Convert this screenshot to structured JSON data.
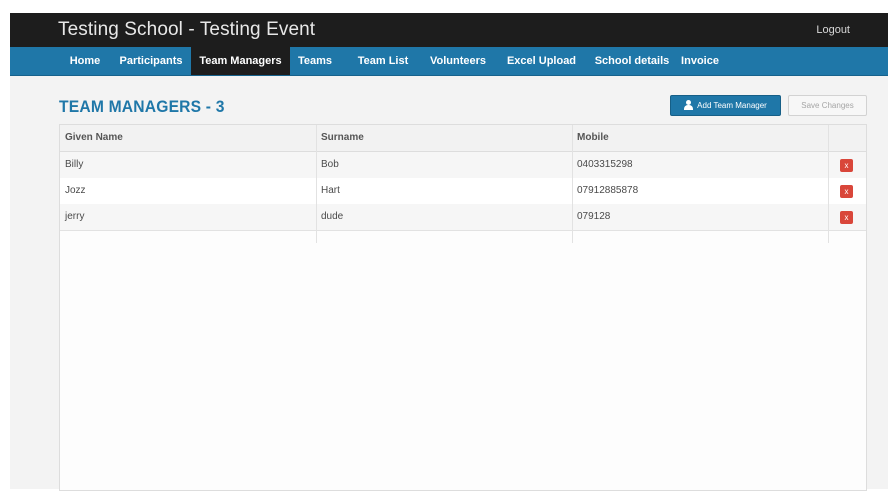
{
  "header": {
    "title": "Testing School - Testing Event",
    "logout_label": "Logout"
  },
  "nav": {
    "items": [
      {
        "label": "Home"
      },
      {
        "label": "Participants"
      },
      {
        "label": "Team Managers"
      },
      {
        "label": "Teams"
      },
      {
        "label": "Team List"
      },
      {
        "label": "Volunteers"
      },
      {
        "label": "Excel Upload"
      },
      {
        "label": "School details"
      },
      {
        "label": "Invoice"
      }
    ],
    "active": "Team Managers"
  },
  "page": {
    "heading": "TEAM MANAGERS - 3",
    "add_button_label": "Add Team Manager",
    "save_button_label": "Save Changes"
  },
  "table": {
    "columns": [
      "Given Name",
      "Surname",
      "Mobile"
    ],
    "rows": [
      {
        "given_name": "Billy",
        "surname": "Bob",
        "mobile": "0403315298",
        "delete_label": "x"
      },
      {
        "given_name": "Jozz",
        "surname": "Hart",
        "mobile": "07912885878",
        "delete_label": "x"
      },
      {
        "given_name": "jerry",
        "surname": "dude",
        "mobile": "079128",
        "delete_label": "x"
      }
    ]
  },
  "colors": {
    "nav_blue": "#1f77a8",
    "topbar": "#1d1d1d",
    "delete_red": "#d9463a"
  },
  "icons": {
    "add_button_icon": "user-icon",
    "delete_icon": "close-icon"
  }
}
